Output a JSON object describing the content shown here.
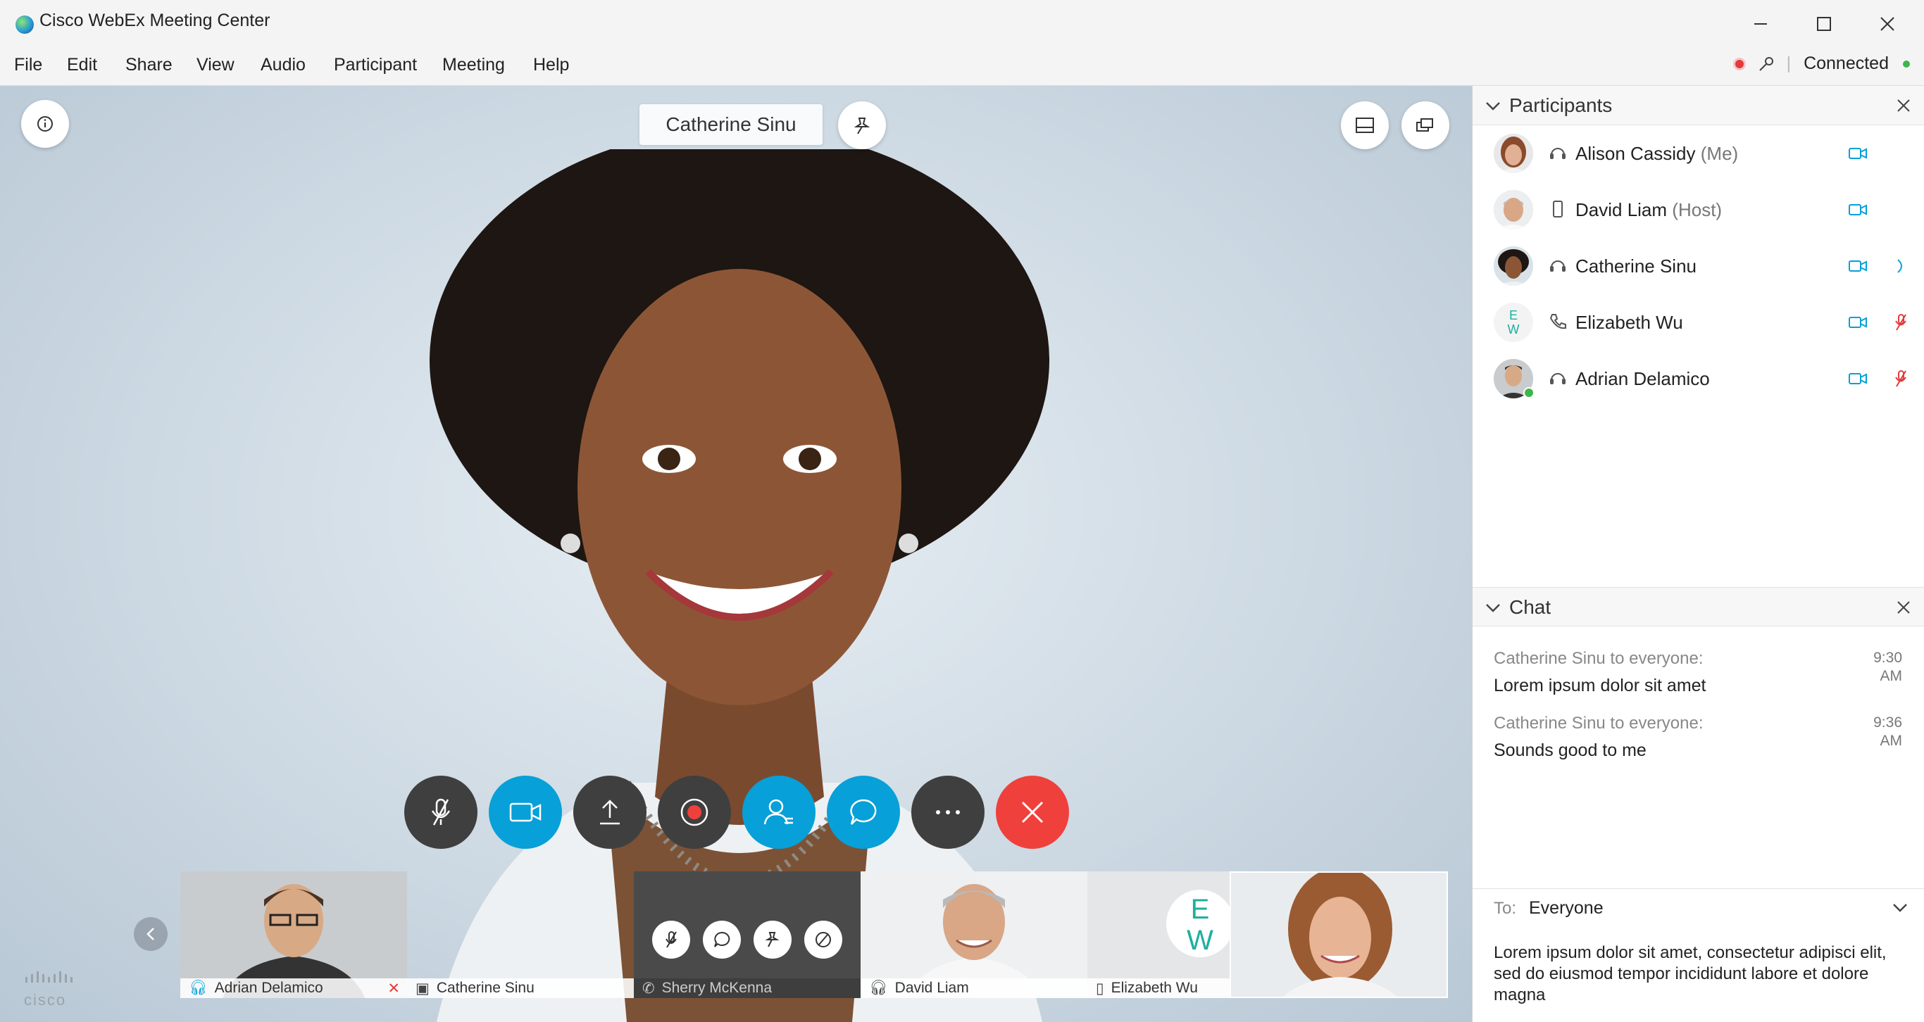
{
  "window": {
    "title": "Cisco WebEx Meeting Center"
  },
  "menu": [
    "File",
    "Edit",
    "Share",
    "View",
    "Audio",
    "Participant",
    "Meeting",
    "Help"
  ],
  "status": {
    "connection": "Connected"
  },
  "video": {
    "active_speaker": "Catherine Sinu",
    "filmstrip": [
      {
        "name": "Adrian Delamico",
        "audio": "headset",
        "muted": true
      },
      {
        "name": "Catherine Sinu",
        "audio": "video-system",
        "muted": false
      },
      {
        "name": "Sherry McKenna",
        "audio": "phone",
        "muted": false,
        "hovered": true
      },
      {
        "name": "David Liam",
        "audio": "headset",
        "muted": false
      },
      {
        "name": "Elizabeth Wu",
        "audio": "mobile",
        "muted": false,
        "initials": "EW"
      },
      {
        "name": "",
        "self_view": true
      }
    ]
  },
  "participants": {
    "title": "Participants",
    "list": [
      {
        "name": "Alison Cassidy",
        "role": "(Me)",
        "audio": "headset",
        "video": true,
        "status": ""
      },
      {
        "name": "David Liam",
        "role": "(Host)",
        "audio": "mobile",
        "video": true,
        "status": ""
      },
      {
        "name": "Catherine Sinu",
        "role": "",
        "audio": "headset",
        "video": true,
        "status": "speaking"
      },
      {
        "name": "Elizabeth Wu",
        "role": "",
        "audio": "phone",
        "video": true,
        "status": "muted",
        "initials": "EW"
      },
      {
        "name": "Adrian Delamico",
        "role": "",
        "audio": "headset",
        "video": true,
        "status": "muted"
      }
    ]
  },
  "chat": {
    "title": "Chat",
    "messages": [
      {
        "sender": "Catherine Sinu to everyone:",
        "text": "Lorem ipsum dolor sit amet",
        "time": "9:30",
        "ampm": "AM"
      },
      {
        "sender": "Catherine Sinu to everyone:",
        "text": "Sounds good to me",
        "time": "9:36",
        "ampm": "AM"
      }
    ],
    "to_label": "To:",
    "to_value": "Everyone",
    "draft": "Lorem ipsum dolor sit amet, consectetur adipisci elit, sed do eiusmod tempor incididunt labore et dolore magna"
  },
  "brand": "cisco",
  "colors": {
    "accent": "#07a0d8",
    "end_call": "#f0403c",
    "muted": "#e23b3b",
    "connected": "#3cb54a"
  }
}
